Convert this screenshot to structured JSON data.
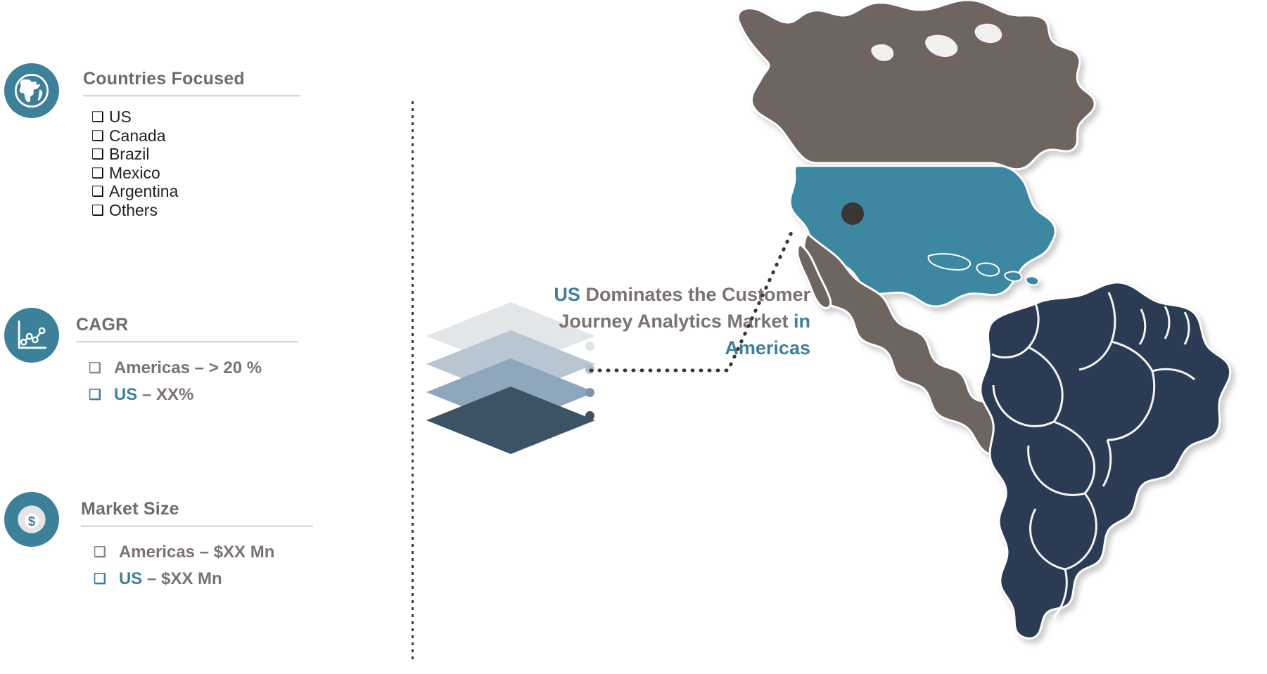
{
  "theme": {
    "accent_teal": "#3d8099",
    "map_us_teal": "#3d87a0",
    "map_gray": "#6e6561",
    "map_navy": "#2b3a52",
    "text_gray": "#7a7371",
    "text_dark": "#231f1e"
  },
  "sections": [
    {
      "id": "countries-focused",
      "title": "Countries Focused",
      "icon": "globe-icon",
      "items": [
        {
          "label": "US"
        },
        {
          "label": "Canada"
        },
        {
          "label": "Brazil"
        },
        {
          "label": "Mexico"
        },
        {
          "label": "Argentina"
        },
        {
          "label": "Others"
        }
      ]
    },
    {
      "id": "cagr",
      "title": "CAGR",
      "icon": "line-chart-icon",
      "items": [
        {
          "accent_text": "Americas",
          "plain_text": " – > 20 %",
          "accent": false
        },
        {
          "accent_text": "US",
          "plain_text": " – XX%",
          "accent": true
        }
      ]
    },
    {
      "id": "market-size",
      "title": "Market Size",
      "icon": "pie-dollar-icon",
      "items": [
        {
          "accent_text": "Americas",
          "plain_text": " – $XX Mn",
          "accent": false
        },
        {
          "accent_text": "US",
          "plain_text": " – $XX Mn",
          "accent": true
        }
      ]
    }
  ],
  "bullet_glyph": "❑",
  "headline": {
    "accent_lead": "US",
    "middle": " Dominates the Customer Journey Analytics Market",
    "accent_tail": "in Americas"
  },
  "stack": {
    "layers": [
      {
        "name": "layer-1",
        "color": "#e2e6e9",
        "dot": "#dfe4e7"
      },
      {
        "name": "layer-2",
        "color": "#b8c6d2",
        "dot": "#aebdc9"
      },
      {
        "name": "layer-3",
        "color": "#8fa7bc",
        "dot": "#7e96ab"
      },
      {
        "name": "layer-4",
        "color": "#3c5366",
        "dot": "#3c5366"
      }
    ]
  },
  "map": {
    "regions": [
      {
        "name": "united-states",
        "color": "#3d87a0",
        "highlighted": true
      },
      {
        "name": "canada",
        "color": "#6e6561",
        "highlighted": false
      },
      {
        "name": "mexico-central-america",
        "color": "#6e6561",
        "highlighted": false
      },
      {
        "name": "south-america",
        "color": "#2b3a52",
        "highlighted": false
      }
    ],
    "marker": {
      "name": "us-marker",
      "color": "#3a3634"
    }
  }
}
